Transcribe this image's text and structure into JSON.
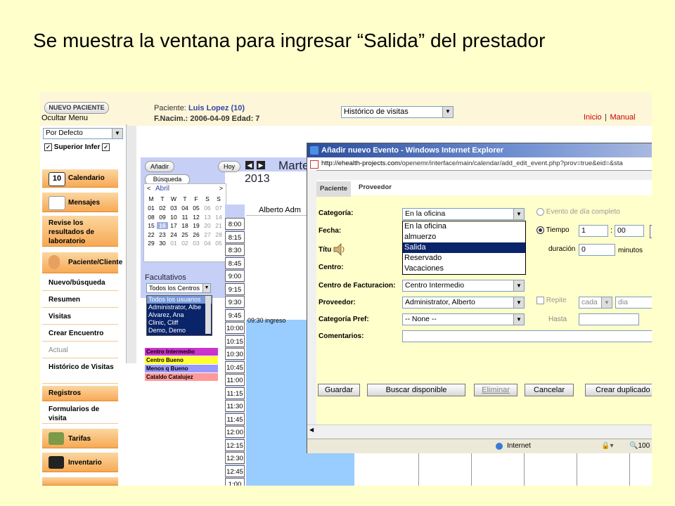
{
  "slide_title": "Se muestra la ventana para ingresar “Salida” del prestador",
  "left_panel": {
    "new_patient_button": "NUEVO PACIENTE",
    "hide_menu": "Ocultar Menu",
    "default_select": "Por Defecto",
    "superior_label": "Superior",
    "infer_label": "Infer",
    "menu": [
      {
        "label": "Calendario",
        "icon": "calendar-icon"
      },
      {
        "label": "Mensajes",
        "icon": "envelope-icon"
      },
      {
        "label": "Revise los resultados de laboratorio"
      },
      {
        "label": "Paciente/Cliente",
        "icon": "person-icon"
      }
    ],
    "submenu": [
      "Nuevo/búsqueda",
      "Resumen",
      "Visitas",
      "Crear Encuentro",
      "Actual",
      "Histórico de Visitas",
      "Registros",
      "Formularios de visita"
    ],
    "tarifas": "Tarifas",
    "inventario": "Inventario"
  },
  "header": {
    "patient_label": "Paciente:",
    "patient_name": "Luis Lopez (10)",
    "dob_line": "F.Nacim.: 2006-04-09 Edad: 7",
    "history_select": "Histórico de visitas",
    "inicio": "Inicio",
    "separator": "|",
    "manual": "Manual"
  },
  "calendar": {
    "add_button": "Añadir",
    "today_button": "Hoy",
    "search_tab": "Búsqueda",
    "day_title": "Marte",
    "year": "2013",
    "month": "Abril",
    "prev": "<",
    "next": ">",
    "weekdays": [
      "M",
      "T",
      "W",
      "T",
      "F",
      "S",
      "S"
    ],
    "weeks": [
      [
        "01",
        "02",
        "03",
        "04",
        "05",
        "06",
        "07"
      ],
      [
        "08",
        "09",
        "10",
        "11",
        "12",
        "13",
        "14"
      ],
      [
        "15",
        "16",
        "17",
        "18",
        "19",
        "20",
        "21"
      ],
      [
        "22",
        "23",
        "24",
        "25",
        "26",
        "27",
        "28"
      ],
      [
        "29",
        "30",
        "01",
        "02",
        "03",
        "04",
        "05"
      ]
    ],
    "providers_label": "Facultativos",
    "centers_select": "Todos los Centros",
    "providers_list": [
      "Todos los usuarios",
      "Administrator, Albe",
      "Alvarez, Ana",
      "Clinic, Cliff",
      "Demo, Demo"
    ],
    "legend": [
      {
        "label": "Centro Intermedio",
        "color": "#cc33cc"
      },
      {
        "label": "Centro Bueno",
        "color": "#ffff33"
      },
      {
        "label": "Menos q Bueno",
        "color": "#9999ff"
      },
      {
        "label": "Cataldo Catalujez",
        "color": "#ff9999"
      }
    ],
    "column_header": "Alberto Adm",
    "times": [
      "8:00",
      "8:15",
      "8:30",
      "8:45",
      "9:00",
      "9:15",
      "9:30",
      "9:45",
      "10:00",
      "10:15",
      "10:30",
      "10:45",
      "11:00",
      "11:15",
      "11:30",
      "11:45",
      "12:00",
      "12:15",
      "12:30",
      "12:45",
      "1:00"
    ],
    "event": "09:30 ingreso"
  },
  "popup": {
    "title": "Añadir nuevo Evento - Windows Internet Explorer",
    "address_host": "http://ehealth-projects.com",
    "address_path": "/openemr/interface/main/calendar/add_edit_event.php?prov=true&eid=&sta",
    "tabs": [
      "Paciente",
      "Proveedor"
    ],
    "labels": {
      "categoria": "Categoría:",
      "fecha": "Fecha:",
      "titulo": "Títu",
      "centro": "Centro:",
      "centro_fact": "Centro de Facturacion:",
      "proveedor": "Proveedor:",
      "cat_pref": "Categoría Pref:",
      "comentarios": "Comentarios:"
    },
    "categoria_value": "En la oficina",
    "category_options": [
      "En la oficina",
      "almuerzo",
      "Salida",
      "Reservado",
      "Vacaciones"
    ],
    "selected_option": "Salida",
    "centro_fact_value": "Centro Intermedio",
    "proveedor_value": "Administrator, Alberto",
    "cat_pref_value": "-- None --",
    "all_day": "Evento de día completo",
    "tiempo": "Tiempo",
    "hour": "1",
    "colon": ":",
    "minute": "00",
    "duracion": "duración",
    "duration_value": "0",
    "minutos": "minutos",
    "repite": "Repite",
    "cada": "cada",
    "dia": "dia",
    "hasta": "Hasta",
    "buttons": [
      "Guardar",
      "Buscar disponible",
      "Eliminar",
      "Cancelar",
      "Crear duplicado"
    ],
    "status_zone": "Internet",
    "zoom": "100"
  }
}
